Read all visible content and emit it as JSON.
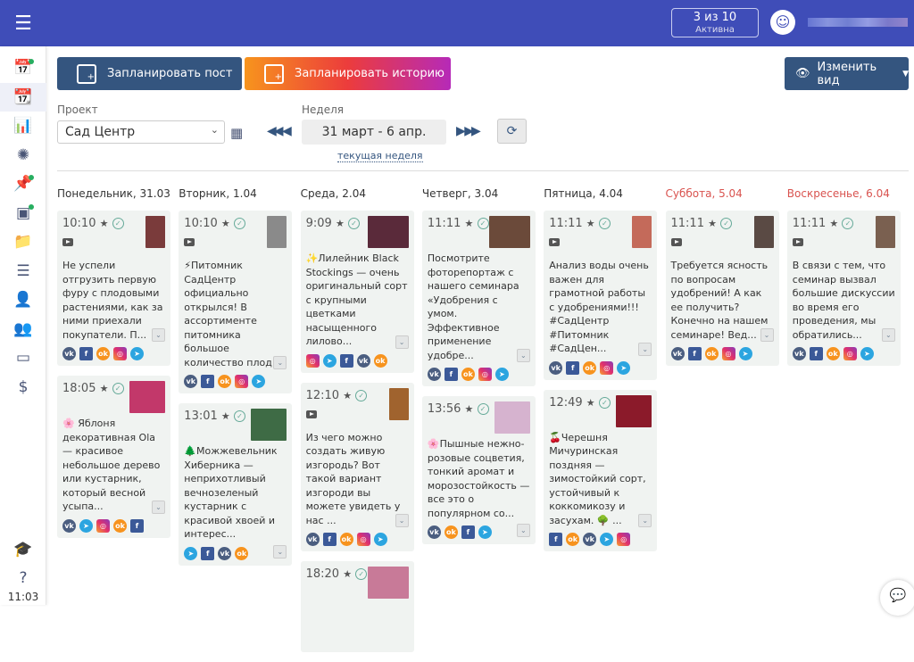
{
  "topbar": {
    "plan_count": "3 из 10",
    "plan_status": "Активна"
  },
  "sidebar": {
    "clock": "11:03",
    "items": [
      "calendar-add",
      "calendar",
      "analytics",
      "openai",
      "pin",
      "layout",
      "folder",
      "rss",
      "add-user",
      "users",
      "billing",
      "money"
    ]
  },
  "toolbar": {
    "schedule_post": "Запланировать пост",
    "schedule_story": "Запланировать историю",
    "change_view": "Изменить вид"
  },
  "filters": {
    "project_label": "Проект",
    "project_value": "Сад Центр",
    "week_label": "Неделя",
    "week_value": "31 март - 6 апр.",
    "current_week": "текущая неделя"
  },
  "colors": {
    "topbar": "#3f4db8",
    "primary": "#34557f",
    "weekend": "#d9534f",
    "card": "#f0f3f1"
  },
  "days": [
    {
      "label": "Понедельник, 31.03",
      "weekend": false,
      "posts": [
        {
          "time": "10:10",
          "video": true,
          "thumb": "#7a3b3b",
          "text": "Не успели отгрузить первую фуру с плодовыми растениями, как за ними приехали покупатели. П...",
          "nets": [
            "vk",
            "fb",
            "ok",
            "ig",
            "tg"
          ]
        },
        {
          "time": "18:05",
          "video": false,
          "thumb": "#c2386a",
          "text": "🌸 Яблоня декоративная Ola — красивое небольшое дерево или кустарник, который весной усыпа...",
          "nets": [
            "vk",
            "tg",
            "ig",
            "ok",
            "fb"
          ]
        }
      ]
    },
    {
      "label": "Вторник, 1.04",
      "weekend": false,
      "posts": [
        {
          "time": "10:10",
          "video": true,
          "thumb": "#8a8a8a",
          "text": "⚡Питомник СадЦентр официально открылся! В ассортименте питомника большое количество плод...",
          "nets": [
            "vk",
            "fb",
            "ok",
            "ig",
            "tg"
          ]
        },
        {
          "time": "13:01",
          "video": false,
          "thumb": "#3e6b45",
          "text": "🌲Можжевельник Хиберника — неприхотливый вечнозеленый кустарник с красивой хвоей и интерес...",
          "nets": [
            "tg",
            "fb",
            "vk",
            "ok"
          ]
        }
      ]
    },
    {
      "label": "Среда, 2.04",
      "weekend": false,
      "posts": [
        {
          "time": "9:09",
          "video": false,
          "thumb": "#5a2a3a",
          "text": "✨Лилейник Black Stockings — очень оригинальный сорт с крупными цветками насыщенного лилово...",
          "nets": [
            "ig",
            "tg",
            "fb",
            "vk",
            "ok"
          ]
        },
        {
          "time": "12:10",
          "video": true,
          "thumb": "#a0632e",
          "text": "Из чего можно создать живую изгородь? Вот такой вариант изгороди вы можете увидеть у нас ...",
          "nets": [
            "vk",
            "fb",
            "ok",
            "ig",
            "tg"
          ]
        },
        {
          "time": "18:20",
          "video": false,
          "thumb": "#c87a98",
          "text": "",
          "nets": []
        }
      ]
    },
    {
      "label": "Четверг, 3.04",
      "weekend": false,
      "posts": [
        {
          "time": "11:11",
          "video": false,
          "thumb": "#6b4a3a",
          "text": "Посмотрите фоторепортаж с нашего семинара «Удобрения с умом. Эффективное применение удобре...",
          "nets": [
            "vk",
            "fb",
            "ok",
            "ig",
            "tg"
          ]
        },
        {
          "time": "13:56",
          "video": false,
          "thumb": "#d6b3cf",
          "text": "🌸Пышные нежно-розовые соцветия, тонкий аромат и морозостойкость — все это о популярном со...",
          "nets": [
            "vk",
            "ok",
            "fb",
            "tg"
          ]
        }
      ]
    },
    {
      "label": "Пятница, 4.04",
      "weekend": false,
      "posts": [
        {
          "time": "11:11",
          "video": true,
          "thumb": "#c46a5a",
          "text": "Анализ воды очень важен для грамотной работы с удобрениями!!! #СадЦентр #Питомник #СадЦен...",
          "nets": [
            "vk",
            "fb",
            "ok",
            "ig",
            "tg"
          ]
        },
        {
          "time": "12:49",
          "video": false,
          "thumb": "#8b1a2a",
          "text": "🍒Черешня Мичуринская поздняя — зимостойкий сорт, устойчивый к коккомикозу и засухам. 🌳 ...",
          "nets": [
            "fb",
            "ok",
            "vk",
            "tg",
            "ig"
          ]
        }
      ]
    },
    {
      "label": "Суббота, 5.04",
      "weekend": true,
      "posts": [
        {
          "time": "11:11",
          "video": true,
          "thumb": "#5a4a44",
          "text": "Требуется ясность по вопросам удобрений! А как ее получить? Конечно на нашем семинаре! Вед...",
          "nets": [
            "vk",
            "fb",
            "ok",
            "ig",
            "tg"
          ]
        }
      ]
    },
    {
      "label": "Воскресенье, 6.04",
      "weekend": true,
      "posts": [
        {
          "time": "11:11",
          "video": true,
          "thumb": "#7a6050",
          "text": "В связи с тем, что семинар вызвал большие дискуссии во время его проведения, мы обратились...",
          "nets": [
            "vk",
            "fb",
            "ok",
            "ig",
            "tg"
          ]
        }
      ]
    }
  ]
}
